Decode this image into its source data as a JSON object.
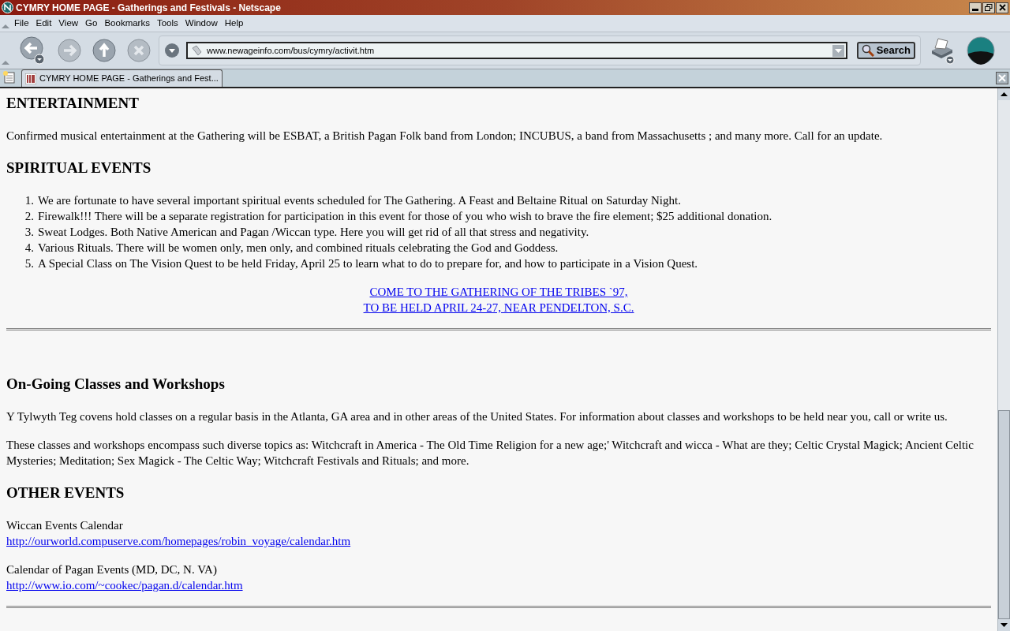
{
  "window": {
    "title": "CYMRY HOME PAGE - Gatherings and Festivals - Netscape"
  },
  "menu": [
    "File",
    "Edit",
    "View",
    "Go",
    "Bookmarks",
    "Tools",
    "Window",
    "Help"
  ],
  "toolbar": {
    "url": "www.newageinfo.com/bus/cymry/activit.htm",
    "search_button": "Search"
  },
  "tabs": [
    {
      "label": "CYMRY HOME PAGE - Gatherings and Fest...",
      "selected": true
    }
  ],
  "content": [
    {
      "kind": "heading",
      "text": "ENTERTAINMENT"
    },
    {
      "kind": "paragraph",
      "text": "Confirmed musical entertainment at the Gathering will be ESBAT, a British Pagan Folk band from London; INCUBUS, a band from Massachusetts ; and many more. Call for an update."
    },
    {
      "kind": "heading",
      "text": "SPIRITUAL EVENTS"
    },
    {
      "kind": "list",
      "items": [
        {
          "number": "1.",
          "text": "We are fortunate to have several important spiritual events scheduled for The Gathering. A Feast and Beltaine Ritual on Saturday Night."
        },
        {
          "number": "2.",
          "text": "Firewalk!!! There will be a separate registration for participation in this event for those of you who wish to brave the fire element; $25 additional donation."
        },
        {
          "number": "3.",
          "text": "Sweat Lodges. Both Native American and Pagan /Wiccan type. Here you will get rid of all that stress and negativity."
        },
        {
          "number": "4.",
          "text": "Various Rituals. There will be women only, men only, and combined rituals celebrating the God and Goddess."
        },
        {
          "number": "5.",
          "text": "A Special Class on The Vision Quest to be held Friday, April 25 to learn what to do to prepare for, and how to participate in a Vision Quest."
        }
      ]
    },
    {
      "kind": "center_links",
      "lines": [
        "COME TO THE GATHERING OF THE TRIBES `97,",
        "TO BE HELD APRIL 24-27, NEAR PENDELTON, S.C."
      ]
    },
    {
      "kind": "rule"
    },
    {
      "kind": "heading",
      "text": "On-Going Classes and Workshops"
    },
    {
      "kind": "paragraph",
      "text": "Y Tylwyth Teg covens hold classes on a regular basis in the Atlanta, GA area and in other areas of the United States. For information about classes and workshops to be held near you, call or write us."
    },
    {
      "kind": "paragraph",
      "text": "These classes and workshops encompass such diverse topics as: Witchcraft in America - The Old Time Religion for a new age;' Witchcraft and wicca - What are they; Celtic Crystal Magick; Ancient Celtic Mysteries; Meditation; Sex Magick - The Celtic Way; Witchcraft Festivals and Rituals; and more."
    },
    {
      "kind": "heading",
      "text": "OTHER EVENTS"
    },
    {
      "kind": "link_entry",
      "label": "Wiccan Events Calendar",
      "url": "http://ourworld.compuserve.com/homepages/robin_voyage/calendar.htm"
    },
    {
      "kind": "link_entry",
      "label": "Calendar of Pagan Events (MD, DC, N. VA)",
      "url": "http://www.io.com/~cookec/pagan.d/calendar.htm"
    },
    {
      "kind": "rule"
    }
  ]
}
